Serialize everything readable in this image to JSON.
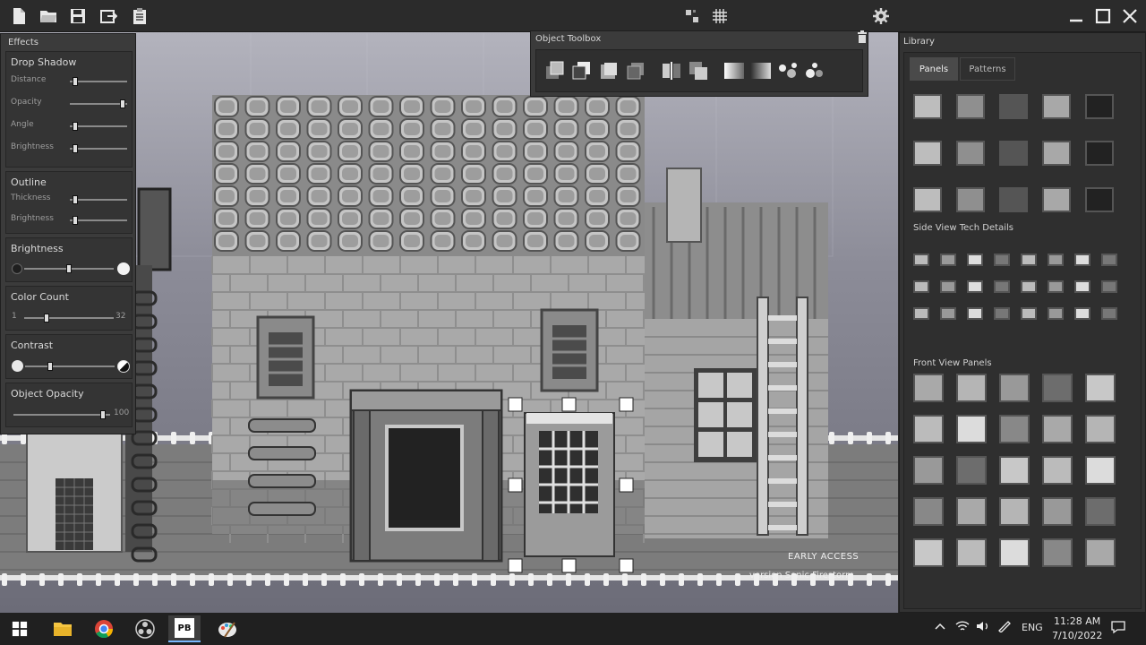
{
  "toolbar": {
    "left_icons": [
      "new-file-icon",
      "open-folder-icon",
      "save-icon",
      "export-icon",
      "clipboard-icon"
    ],
    "center_icons": [
      "pixel-grid-icon",
      "grid-icon"
    ],
    "right_icons": [
      "settings-gear-icon"
    ],
    "window_controls": [
      "minimize-icon",
      "maximize-icon",
      "close-icon"
    ]
  },
  "effects": {
    "title": "Effects",
    "drop_shadow": {
      "title": "Drop Shadow",
      "rows": [
        {
          "label": "Distance",
          "value": 0.05
        },
        {
          "label": "Opacity",
          "value": 0.95
        },
        {
          "label": "Angle",
          "value": 0.05
        },
        {
          "label": "Brightness",
          "value": 0.05
        }
      ]
    },
    "outline": {
      "title": "Outline",
      "rows": [
        {
          "label": "Thickness",
          "value": 0.05
        },
        {
          "label": "Brightness",
          "value": 0.05
        }
      ]
    },
    "brightness": {
      "title": "Brightness",
      "value": 0.5
    },
    "color_count": {
      "title": "Color Count",
      "min_label": "1",
      "max_label": "32",
      "value": 0.3
    },
    "contrast": {
      "title": "Contrast",
      "value": 0.3
    },
    "object_opacity": {
      "title": "Object Opacity",
      "value_label": "100",
      "value": 1.0
    }
  },
  "object_toolbox": {
    "title": "Object Toolbox",
    "tools": [
      "bring-to-front-icon",
      "send-to-back-icon",
      "bring-forward-icon",
      "send-backward-icon",
      "flip-horizontal-icon",
      "duplicate-icon",
      "gradient-light-icon",
      "gradient-dark-icon",
      "add-dots-icon",
      "remove-dots-icon"
    ]
  },
  "library": {
    "title": "Library",
    "tabs": [
      {
        "label": "Panels",
        "active": true
      },
      {
        "label": "Patterns",
        "active": false
      }
    ],
    "sections": [
      {
        "label": "Side View Tech Details"
      },
      {
        "label": "Front View Panels"
      }
    ]
  },
  "canvas": {
    "watermark_line1": "EARLY ACCESS",
    "watermark_line2": "version Sonic Firestorm"
  },
  "taskbar": {
    "apps": [
      "windows-start-icon",
      "file-explorer-icon",
      "chrome-icon",
      "obs-icon",
      "pixel-builder-app-icon",
      "paint-icon"
    ],
    "active_app_label": "PB",
    "language": "ENG",
    "time": "11:28 AM",
    "date": "7/10/2022"
  },
  "colors": {
    "bg_dark": "#2b2b2b",
    "panel": "#3b3b3b",
    "accent_tab": "#4a4a4a"
  }
}
